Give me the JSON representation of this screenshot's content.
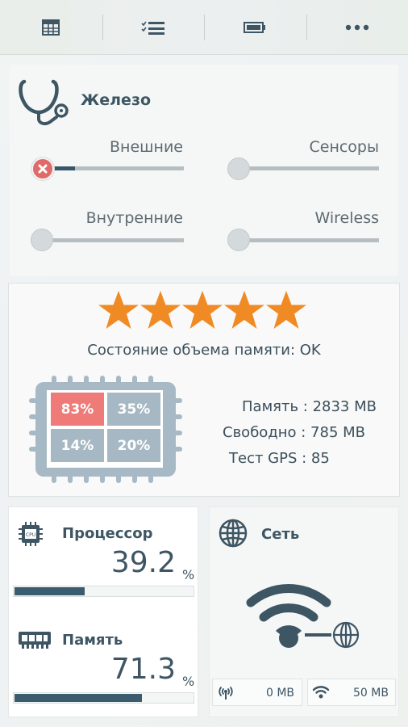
{
  "tabs": [
    {
      "icon": "table-icon"
    },
    {
      "icon": "checklist-icon"
    },
    {
      "icon": "battery-icon"
    },
    {
      "icon": "more-icon"
    }
  ],
  "hardware": {
    "title": "Железо",
    "sliders": [
      {
        "label": "Внешние",
        "state": "error",
        "level": 0.22
      },
      {
        "label": "Сенсоры",
        "state": "off",
        "level": 0
      },
      {
        "label": "Внутренние",
        "state": "off",
        "level": 0
      },
      {
        "label": "Wireless",
        "state": "off",
        "level": 0
      }
    ]
  },
  "status": {
    "stars": 5,
    "text": "Состояние объема памяти: OK",
    "cells": [
      "83%",
      "35%",
      "14%",
      "20%"
    ],
    "memory_label": "Память : 2833 MB",
    "free_label": "Свободно : 785 MB",
    "gps_label": "Тест GPS : 85"
  },
  "cpu": {
    "title": "Процессор",
    "value": "39.2",
    "unit": "%",
    "level": 0.392
  },
  "memory": {
    "title": "Память",
    "value": "71.3",
    "unit": "%",
    "level": 0.713
  },
  "network": {
    "title": "Сеть",
    "cellular": "0 MB",
    "wifi": "50 MB"
  },
  "colors": {
    "accent": "#3e5564",
    "star": "#f08a24",
    "cell_alert": "#ee7b78",
    "cell_normal": "#a5b8c3"
  }
}
